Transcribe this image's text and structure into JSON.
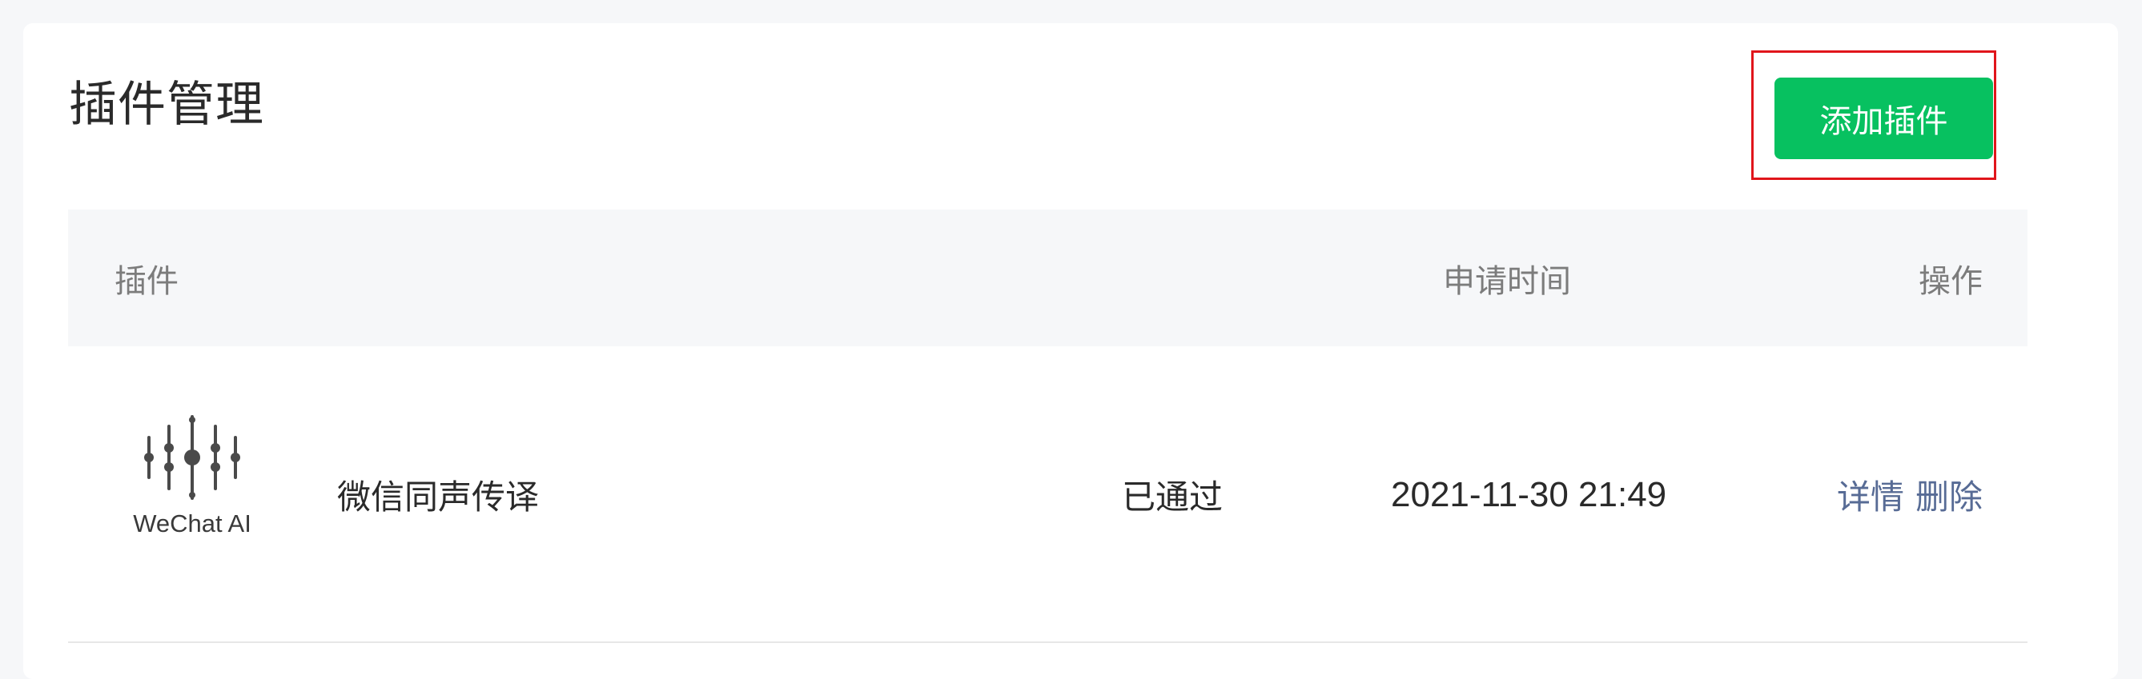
{
  "page": {
    "title": "插件管理",
    "add_button_label": "添加插件"
  },
  "table": {
    "headers": {
      "plugin": "插件",
      "time": "申请时间",
      "action": "操作"
    },
    "rows": [
      {
        "logo_text": "WeChat AI",
        "name": "微信同声传译",
        "status": "已通过",
        "time": "2021-11-30 21:49",
        "detail_label": "详情",
        "delete_label": "删除"
      }
    ]
  },
  "colors": {
    "accent": "#07c160",
    "link": "#576b95",
    "highlight": "#e0151b"
  }
}
